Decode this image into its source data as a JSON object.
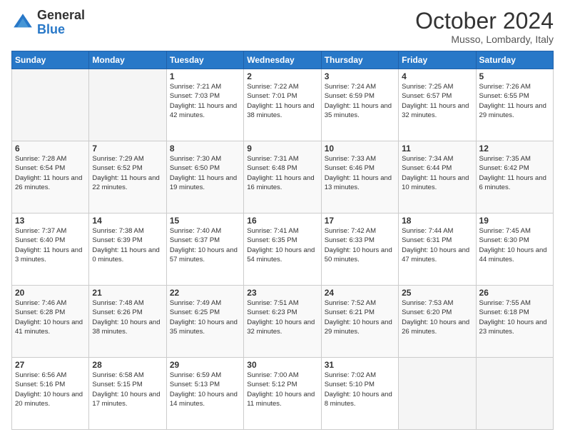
{
  "logo": {
    "general": "General",
    "blue": "Blue"
  },
  "header": {
    "month": "October 2024",
    "location": "Musso, Lombardy, Italy"
  },
  "weekdays": [
    "Sunday",
    "Monday",
    "Tuesday",
    "Wednesday",
    "Thursday",
    "Friday",
    "Saturday"
  ],
  "weeks": [
    [
      {
        "day": "",
        "empty": true
      },
      {
        "day": "",
        "empty": true
      },
      {
        "day": "1",
        "sunrise": "7:21 AM",
        "sunset": "7:03 PM",
        "daylight": "11 hours and 42 minutes."
      },
      {
        "day": "2",
        "sunrise": "7:22 AM",
        "sunset": "7:01 PM",
        "daylight": "11 hours and 38 minutes."
      },
      {
        "day": "3",
        "sunrise": "7:24 AM",
        "sunset": "6:59 PM",
        "daylight": "11 hours and 35 minutes."
      },
      {
        "day": "4",
        "sunrise": "7:25 AM",
        "sunset": "6:57 PM",
        "daylight": "11 hours and 32 minutes."
      },
      {
        "day": "5",
        "sunrise": "7:26 AM",
        "sunset": "6:55 PM",
        "daylight": "11 hours and 29 minutes."
      }
    ],
    [
      {
        "day": "6",
        "sunrise": "7:28 AM",
        "sunset": "6:54 PM",
        "daylight": "11 hours and 26 minutes."
      },
      {
        "day": "7",
        "sunrise": "7:29 AM",
        "sunset": "6:52 PM",
        "daylight": "11 hours and 22 minutes."
      },
      {
        "day": "8",
        "sunrise": "7:30 AM",
        "sunset": "6:50 PM",
        "daylight": "11 hours and 19 minutes."
      },
      {
        "day": "9",
        "sunrise": "7:31 AM",
        "sunset": "6:48 PM",
        "daylight": "11 hours and 16 minutes."
      },
      {
        "day": "10",
        "sunrise": "7:33 AM",
        "sunset": "6:46 PM",
        "daylight": "11 hours and 13 minutes."
      },
      {
        "day": "11",
        "sunrise": "7:34 AM",
        "sunset": "6:44 PM",
        "daylight": "11 hours and 10 minutes."
      },
      {
        "day": "12",
        "sunrise": "7:35 AM",
        "sunset": "6:42 PM",
        "daylight": "11 hours and 6 minutes."
      }
    ],
    [
      {
        "day": "13",
        "sunrise": "7:37 AM",
        "sunset": "6:40 PM",
        "daylight": "11 hours and 3 minutes."
      },
      {
        "day": "14",
        "sunrise": "7:38 AM",
        "sunset": "6:39 PM",
        "daylight": "11 hours and 0 minutes."
      },
      {
        "day": "15",
        "sunrise": "7:40 AM",
        "sunset": "6:37 PM",
        "daylight": "10 hours and 57 minutes."
      },
      {
        "day": "16",
        "sunrise": "7:41 AM",
        "sunset": "6:35 PM",
        "daylight": "10 hours and 54 minutes."
      },
      {
        "day": "17",
        "sunrise": "7:42 AM",
        "sunset": "6:33 PM",
        "daylight": "10 hours and 50 minutes."
      },
      {
        "day": "18",
        "sunrise": "7:44 AM",
        "sunset": "6:31 PM",
        "daylight": "10 hours and 47 minutes."
      },
      {
        "day": "19",
        "sunrise": "7:45 AM",
        "sunset": "6:30 PM",
        "daylight": "10 hours and 44 minutes."
      }
    ],
    [
      {
        "day": "20",
        "sunrise": "7:46 AM",
        "sunset": "6:28 PM",
        "daylight": "10 hours and 41 minutes."
      },
      {
        "day": "21",
        "sunrise": "7:48 AM",
        "sunset": "6:26 PM",
        "daylight": "10 hours and 38 minutes."
      },
      {
        "day": "22",
        "sunrise": "7:49 AM",
        "sunset": "6:25 PM",
        "daylight": "10 hours and 35 minutes."
      },
      {
        "day": "23",
        "sunrise": "7:51 AM",
        "sunset": "6:23 PM",
        "daylight": "10 hours and 32 minutes."
      },
      {
        "day": "24",
        "sunrise": "7:52 AM",
        "sunset": "6:21 PM",
        "daylight": "10 hours and 29 minutes."
      },
      {
        "day": "25",
        "sunrise": "7:53 AM",
        "sunset": "6:20 PM",
        "daylight": "10 hours and 26 minutes."
      },
      {
        "day": "26",
        "sunrise": "7:55 AM",
        "sunset": "6:18 PM",
        "daylight": "10 hours and 23 minutes."
      }
    ],
    [
      {
        "day": "27",
        "sunrise": "6:56 AM",
        "sunset": "5:16 PM",
        "daylight": "10 hours and 20 minutes."
      },
      {
        "day": "28",
        "sunrise": "6:58 AM",
        "sunset": "5:15 PM",
        "daylight": "10 hours and 17 minutes."
      },
      {
        "day": "29",
        "sunrise": "6:59 AM",
        "sunset": "5:13 PM",
        "daylight": "10 hours and 14 minutes."
      },
      {
        "day": "30",
        "sunrise": "7:00 AM",
        "sunset": "5:12 PM",
        "daylight": "10 hours and 11 minutes."
      },
      {
        "day": "31",
        "sunrise": "7:02 AM",
        "sunset": "5:10 PM",
        "daylight": "10 hours and 8 minutes."
      },
      {
        "day": "",
        "empty": true
      },
      {
        "day": "",
        "empty": true
      }
    ]
  ]
}
